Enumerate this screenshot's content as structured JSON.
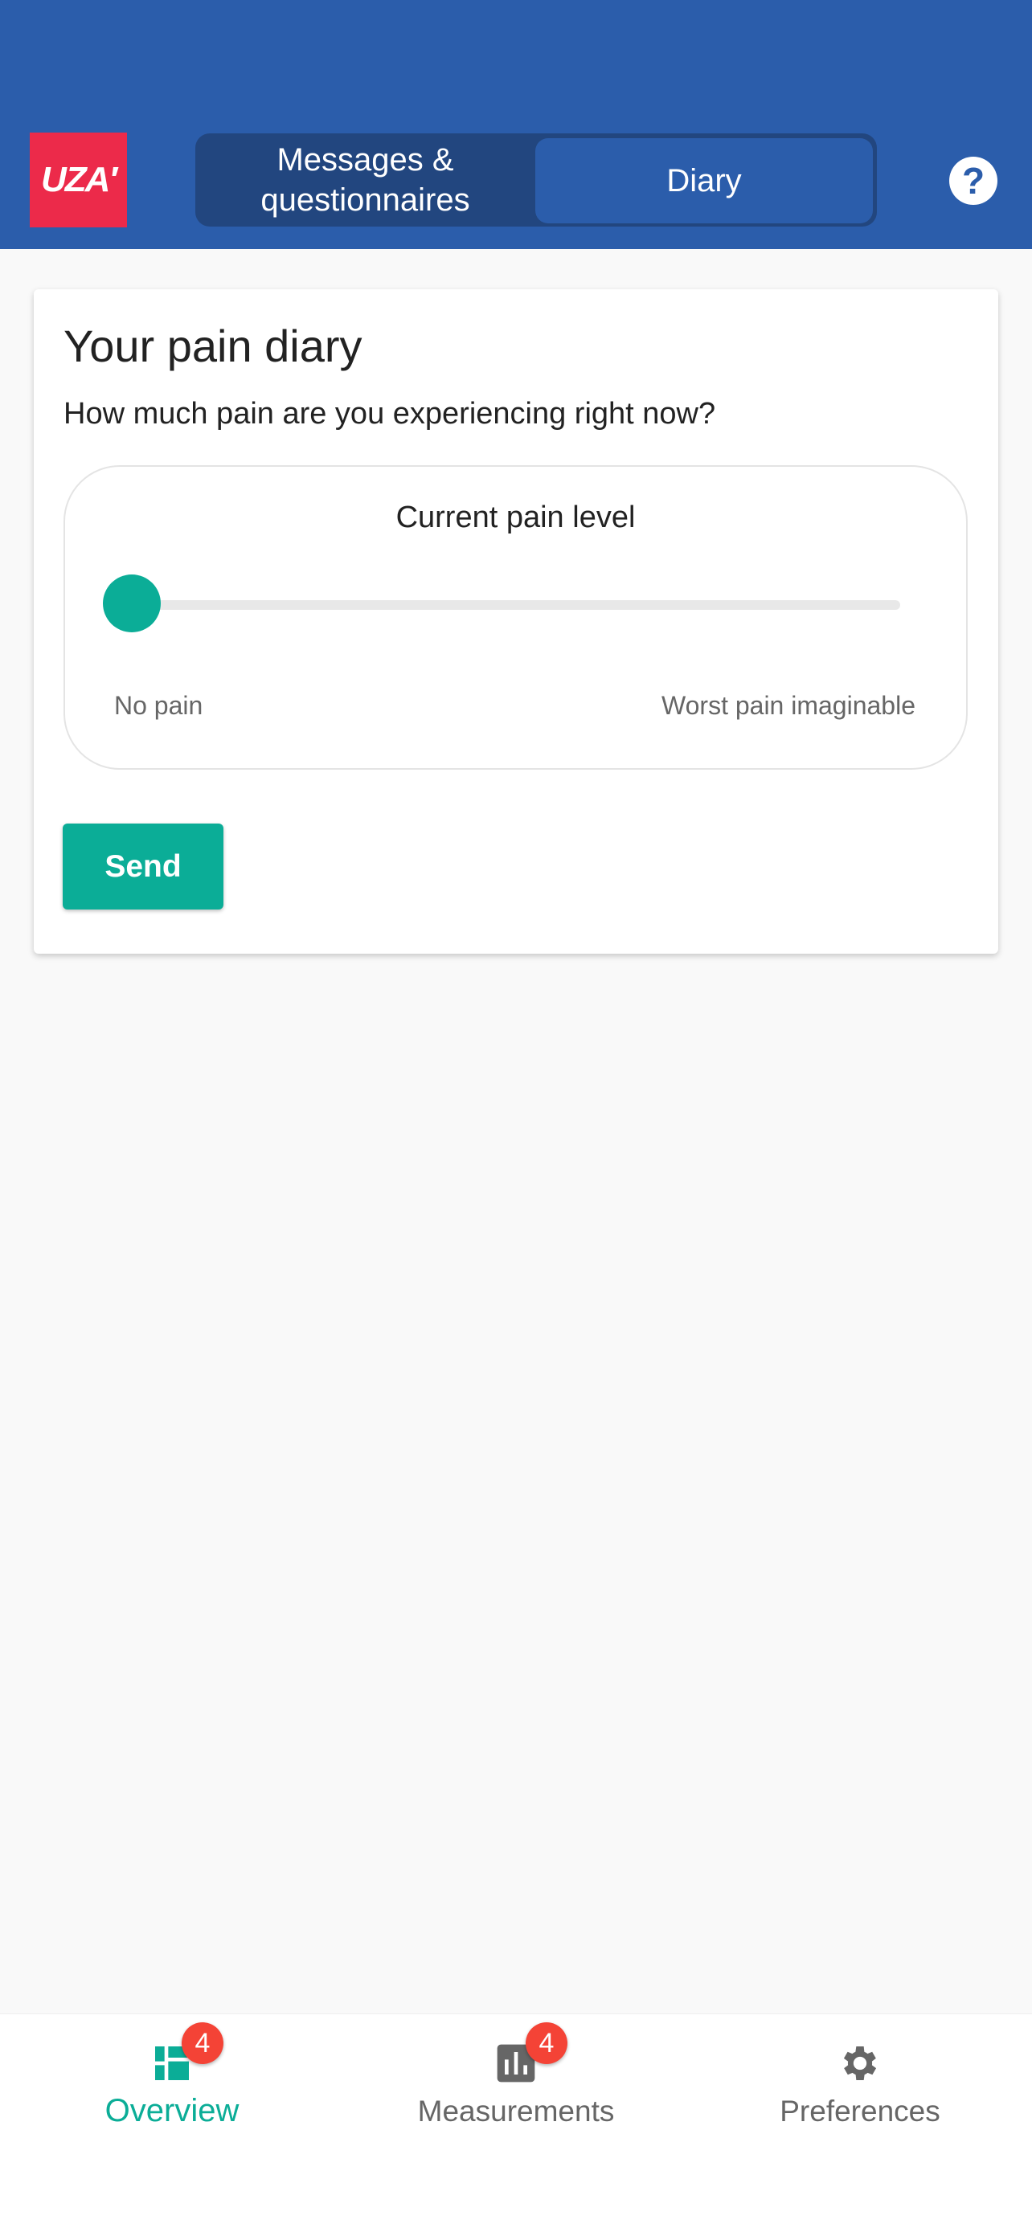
{
  "header": {
    "logo_text": "UZA",
    "tabs": [
      {
        "label": "Messages & questionnaires",
        "active": false
      },
      {
        "label": "Diary",
        "active": true
      }
    ],
    "help_icon": "help-circle-icon"
  },
  "card": {
    "title": "Your pain diary",
    "question": "How much pain are you experiencing right now?",
    "slider": {
      "label": "Current pain level",
      "min_label": "No pain",
      "max_label": "Worst pain imaginable",
      "value": 0
    },
    "send_label": "Send"
  },
  "nav": {
    "items": [
      {
        "label": "Overview",
        "icon": "dashboard-icon",
        "badge": "4",
        "active": true
      },
      {
        "label": "Measurements",
        "icon": "bar-chart-icon",
        "badge": "4",
        "active": false
      },
      {
        "label": "Preferences",
        "icon": "gear-icon",
        "active": false
      }
    ]
  },
  "colors": {
    "header": "#2b5dab",
    "accent": "#0bad97",
    "badge": "#f44336",
    "logo": "#ec2a4a"
  }
}
